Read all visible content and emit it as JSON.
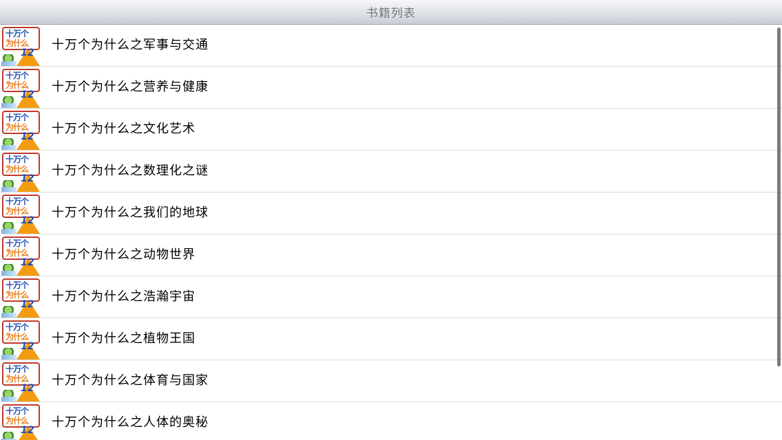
{
  "navbar": {
    "title": "书籍列表"
  },
  "cover": {
    "line1": "十万个",
    "line2": "为什么",
    "number": "12"
  },
  "books": [
    {
      "title": "十万个为什么之军事与交通"
    },
    {
      "title": "十万个为什么之营养与健康"
    },
    {
      "title": "十万个为什么之文化艺术"
    },
    {
      "title": "十万个为什么之数理化之谜"
    },
    {
      "title": "十万个为什么之我们的地球"
    },
    {
      "title": "十万个为什么之动物世界"
    },
    {
      "title": "十万个为什么之浩瀚宇宙"
    },
    {
      "title": "十万个为什么之植物王国"
    },
    {
      "title": "十万个为什么之体育与国家"
    },
    {
      "title": "十万个为什么之人体的奥秘"
    }
  ]
}
